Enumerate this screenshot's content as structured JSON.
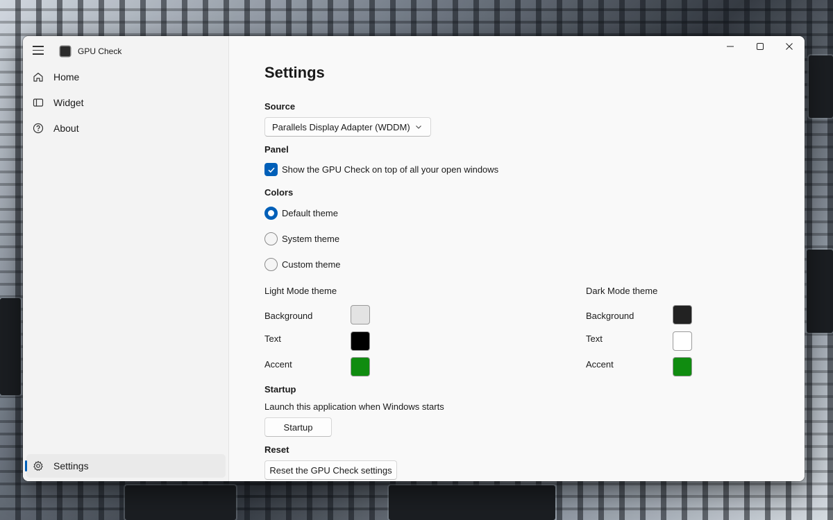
{
  "app": {
    "title": "GPU Check"
  },
  "sidebar": {
    "items": [
      {
        "label": "Home",
        "icon": "home-icon"
      },
      {
        "label": "Widget",
        "icon": "widget-icon"
      },
      {
        "label": "About",
        "icon": "help-icon"
      }
    ],
    "footer_item": {
      "label": "Settings",
      "icon": "gear-icon",
      "selected": true
    }
  },
  "window_controls": {
    "minimize": "—",
    "maximize": "☐",
    "close": "✕"
  },
  "settings": {
    "title": "Settings",
    "source": {
      "heading": "Source",
      "selected": "Parallels Display Adapter (WDDM)"
    },
    "panel": {
      "heading": "Panel",
      "checkbox_label": "Show the GPU Check on top of all your open windows",
      "checked": true
    },
    "colors": {
      "heading": "Colors",
      "options": [
        {
          "label": "Default theme",
          "checked": true
        },
        {
          "label": "System theme",
          "checked": false
        },
        {
          "label": "Custom theme",
          "checked": false
        }
      ],
      "light": {
        "heading": "Light Mode theme",
        "background_label": "Background",
        "background_color": "#e3e3e3",
        "text_label": "Text",
        "text_color": "#000000",
        "accent_label": "Accent",
        "accent_color": "#108c10"
      },
      "dark": {
        "heading": "Dark Mode theme",
        "background_label": "Background",
        "background_color": "#222222",
        "text_label": "Text",
        "text_color": "#ffffff",
        "accent_label": "Accent",
        "accent_color": "#108c10"
      }
    },
    "startup": {
      "heading": "Startup",
      "description": "Launch this application when Windows starts",
      "button_label": "Startup"
    },
    "reset": {
      "heading": "Reset",
      "button_label": "Reset the GPU Check settings"
    }
  },
  "theme": {
    "accent": "#005fb8"
  }
}
